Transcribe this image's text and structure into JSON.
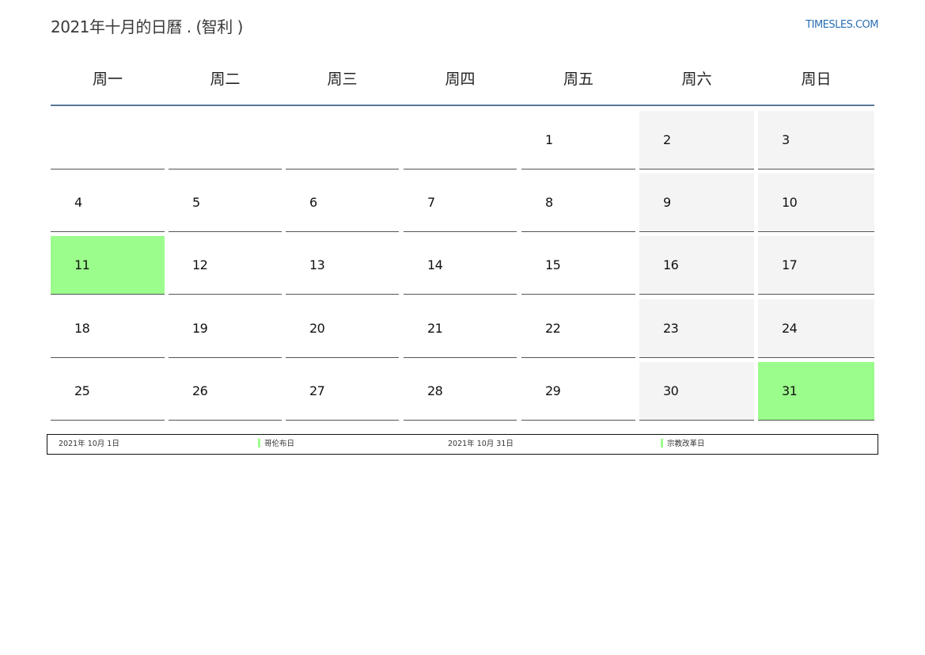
{
  "header": {
    "title": "2021年十月的日曆 . (智利 )",
    "site": "TIMESLES.COM"
  },
  "weekdays": [
    "周一",
    "周二",
    "周三",
    "周四",
    "周五",
    "周六",
    "周日"
  ],
  "weeks": [
    [
      {
        "day": "",
        "type": "normal"
      },
      {
        "day": "",
        "type": "normal"
      },
      {
        "day": "",
        "type": "normal"
      },
      {
        "day": "",
        "type": "normal"
      },
      {
        "day": "1",
        "type": "normal"
      },
      {
        "day": "2",
        "type": "weekend"
      },
      {
        "day": "3",
        "type": "weekend"
      }
    ],
    [
      {
        "day": "4",
        "type": "normal"
      },
      {
        "day": "5",
        "type": "normal"
      },
      {
        "day": "6",
        "type": "normal"
      },
      {
        "day": "7",
        "type": "normal"
      },
      {
        "day": "8",
        "type": "normal"
      },
      {
        "day": "9",
        "type": "weekend"
      },
      {
        "day": "10",
        "type": "weekend"
      }
    ],
    [
      {
        "day": "11",
        "type": "holiday"
      },
      {
        "day": "12",
        "type": "normal"
      },
      {
        "day": "13",
        "type": "normal"
      },
      {
        "day": "14",
        "type": "normal"
      },
      {
        "day": "15",
        "type": "normal"
      },
      {
        "day": "16",
        "type": "weekend"
      },
      {
        "day": "17",
        "type": "weekend"
      }
    ],
    [
      {
        "day": "18",
        "type": "normal"
      },
      {
        "day": "19",
        "type": "normal"
      },
      {
        "day": "20",
        "type": "normal"
      },
      {
        "day": "21",
        "type": "normal"
      },
      {
        "day": "22",
        "type": "normal"
      },
      {
        "day": "23",
        "type": "weekend"
      },
      {
        "day": "24",
        "type": "weekend"
      }
    ],
    [
      {
        "day": "25",
        "type": "normal"
      },
      {
        "day": "26",
        "type": "normal"
      },
      {
        "day": "27",
        "type": "normal"
      },
      {
        "day": "28",
        "type": "normal"
      },
      {
        "day": "29",
        "type": "normal"
      },
      {
        "day": "30",
        "type": "weekend"
      },
      {
        "day": "31",
        "type": "holiday"
      }
    ]
  ],
  "legend": [
    {
      "date": "2021年 10月 1日",
      "name": "哥伦布日"
    },
    {
      "date": "2021年 10月 31日",
      "name": "宗教改革日"
    }
  ],
  "colors": {
    "holiday": "#9bfd8b",
    "weekend": "#f4f4f4",
    "header_rule": "#5a7898",
    "link": "#2a6fb5"
  }
}
